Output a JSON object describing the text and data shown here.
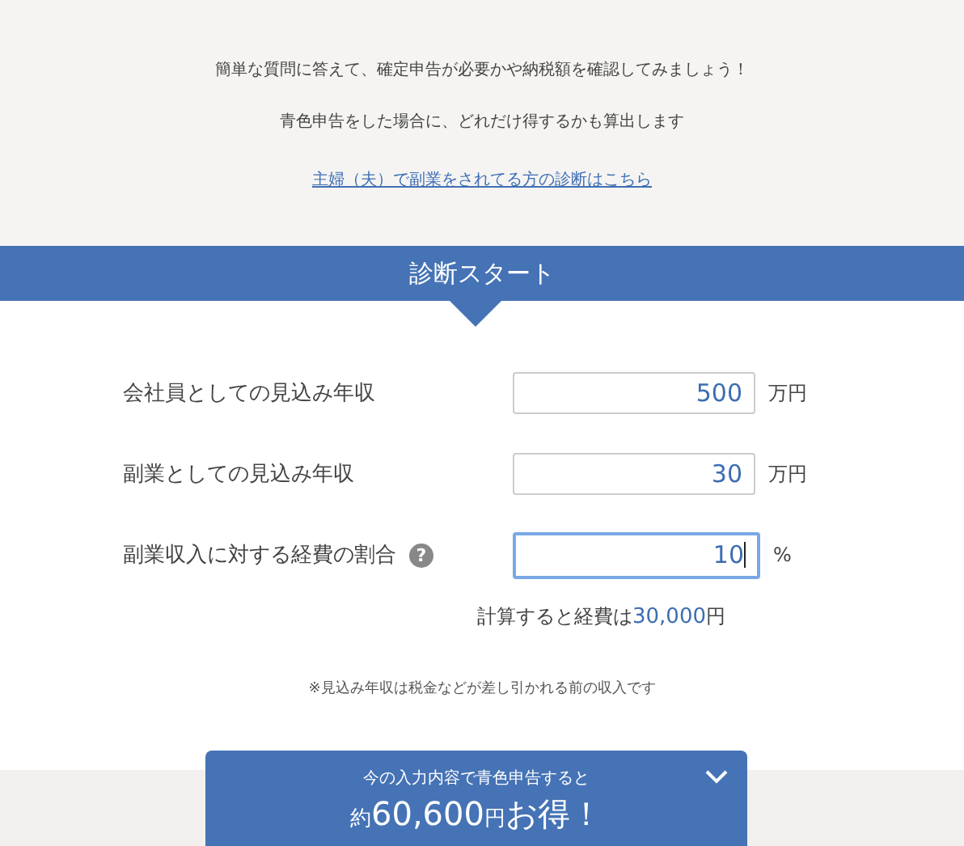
{
  "intro": {
    "lines": [
      "簡単な質問に答えて、確定申告が必要かや納税額を確認してみましょう！",
      "青色申告をした場合に、どれだけ得するかも算出します"
    ],
    "link": "主婦（夫）で副業をされてる方の診断はこちら"
  },
  "banner": {
    "title": "診断スタート"
  },
  "fields": [
    {
      "label": "会社員としての見込み年収",
      "value": "500",
      "unit": "万円",
      "focused": false
    },
    {
      "label": "副業としての見込み年収",
      "value": "30",
      "unit": "万円",
      "focused": false
    },
    {
      "label": "副業収入に対する経費の割合",
      "help": "?",
      "value": "10",
      "unit": "%",
      "focused": true
    }
  ],
  "calculation": {
    "prefix": "計算すると経費は",
    "amount": "30,000",
    "suffix": "円"
  },
  "note": "※見込み年収は税金などが差し引かれる前の収入です",
  "result": {
    "caption": "今の入力内容で青色申告すると",
    "headline_parts": [
      {
        "text": "約",
        "emphasis": false
      },
      {
        "text": "60,600",
        "emphasis": true
      },
      {
        "text": "円",
        "emphasis": false
      },
      {
        "text": "お得！",
        "emphasis": true
      }
    ]
  }
}
